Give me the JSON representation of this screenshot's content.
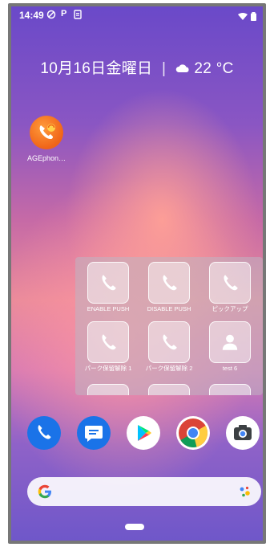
{
  "status_bar": {
    "time": "14:49",
    "app_icon_p": "P"
  },
  "date_widget": {
    "date": "10月16日金曜日",
    "separator": "|",
    "temperature": "22 °C"
  },
  "home_apps": [
    {
      "label": "AGEphon…",
      "icon": "agephone-icon"
    }
  ],
  "widget": {
    "tiles": [
      {
        "label": "ENABLE PUSH",
        "icon": "phone-icon"
      },
      {
        "label": "DISABLE PUSH",
        "icon": "phone-icon"
      },
      {
        "label": "ピックアップ",
        "icon": "phone-icon"
      },
      {
        "label": "パーク保留解除 1",
        "icon": "phone-icon"
      },
      {
        "label": "パーク保留解除 2",
        "icon": "phone-icon"
      },
      {
        "label": "test 6",
        "icon": "person-icon"
      }
    ]
  },
  "dock": [
    {
      "icon": "phone-icon"
    },
    {
      "icon": "messages-icon"
    },
    {
      "icon": "play-store-icon"
    },
    {
      "icon": "chrome-icon"
    },
    {
      "icon": "camera-icon"
    }
  ],
  "search": {
    "placeholder": ""
  },
  "colors": {
    "phone_blue": "#1a73e8",
    "agephone_orange": "#f06418"
  }
}
